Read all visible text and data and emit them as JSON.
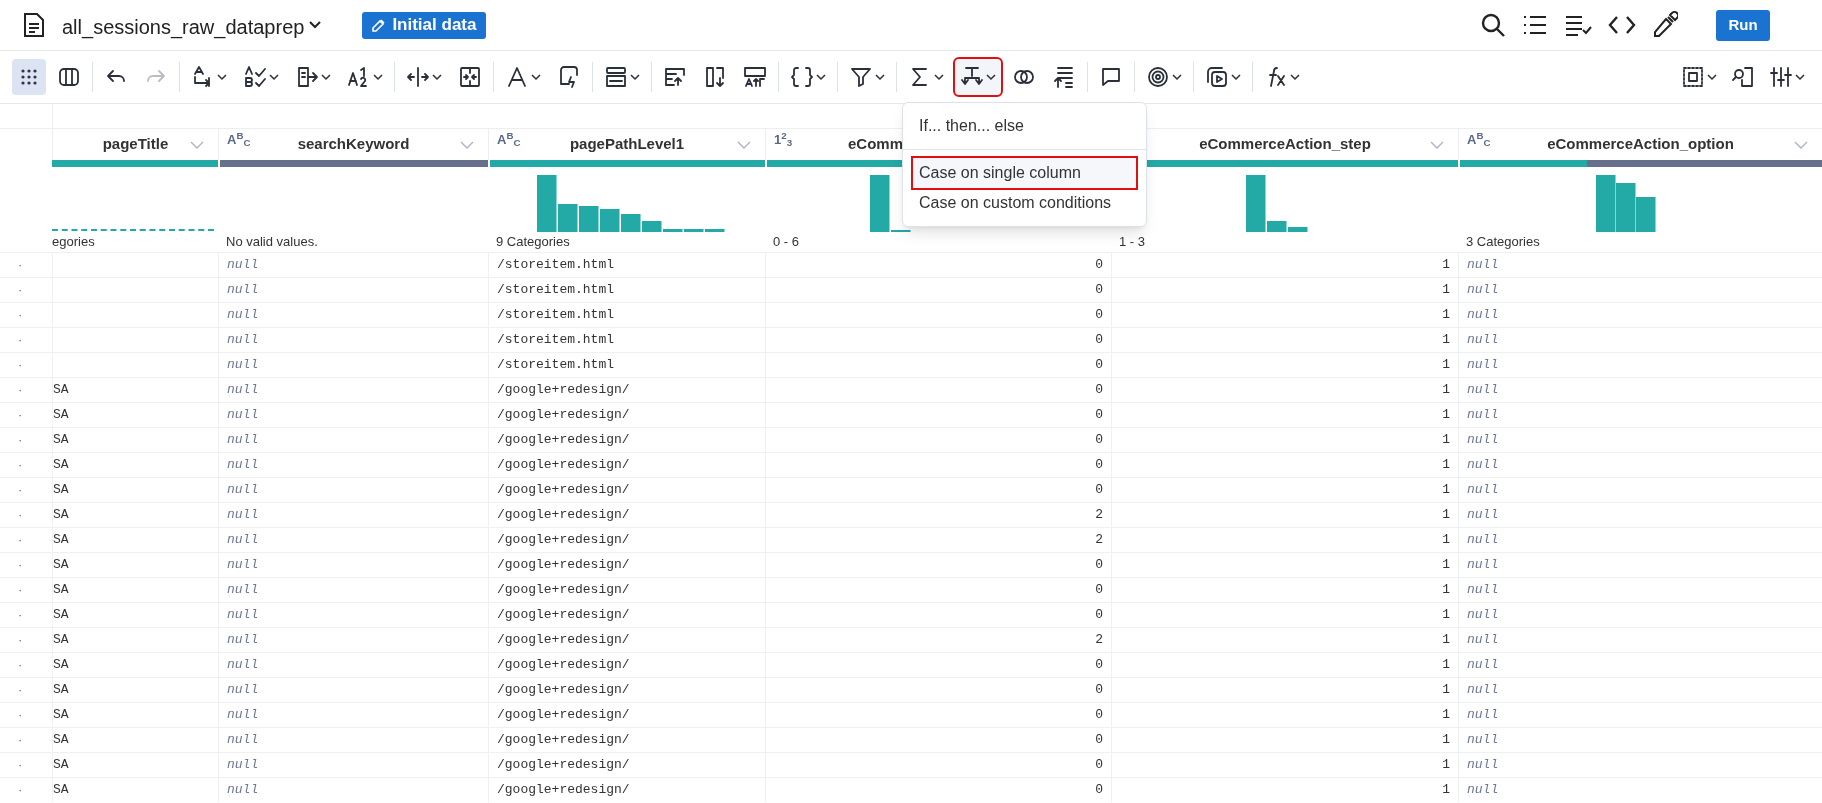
{
  "header": {
    "title": "all_sessions_raw_dataprep",
    "badge": "Initial data",
    "run_button": "Run"
  },
  "toolbar_left": [
    [
      {
        "kind": "grid",
        "caret": false,
        "selected": true
      },
      {
        "kind": "columns",
        "caret": false,
        "selected": false
      }
    ],
    [
      {
        "kind": "undo",
        "caret": false,
        "selected": false
      },
      {
        "kind": "redo",
        "caret": false,
        "selected": false,
        "disabled": true
      }
    ],
    [
      {
        "kind": "rename",
        "caret": true,
        "selected": false
      },
      {
        "kind": "spellcheck",
        "caret": true,
        "selected": false
      },
      {
        "kind": "export",
        "caret": true,
        "selected": false
      },
      {
        "kind": "numbering",
        "caret": true,
        "selected": false
      }
    ],
    [
      {
        "kind": "split",
        "caret": true,
        "selected": false
      },
      {
        "kind": "merge",
        "caret": false,
        "selected": false
      }
    ],
    [
      {
        "kind": "font",
        "caret": true,
        "selected": false
      },
      {
        "kind": "card",
        "caret": false,
        "selected": false
      }
    ],
    [
      {
        "kind": "rows",
        "caret": true,
        "selected": false
      }
    ],
    [
      {
        "kind": "table-up",
        "caret": false,
        "selected": false
      },
      {
        "kind": "column-down",
        "caret": false,
        "selected": false
      },
      {
        "kind": "text-up",
        "caret": false,
        "selected": false
      }
    ],
    [
      {
        "kind": "braces",
        "caret": true,
        "selected": false
      }
    ],
    [
      {
        "kind": "filter",
        "caret": true,
        "selected": false
      }
    ],
    [
      {
        "kind": "sigma",
        "caret": true,
        "selected": false
      },
      {
        "kind": "branch",
        "caret": true,
        "selected": false,
        "open": true
      },
      {
        "kind": "venn",
        "caret": false,
        "selected": false
      },
      {
        "kind": "sort",
        "caret": false,
        "selected": false
      }
    ],
    [
      {
        "kind": "comment",
        "caret": false,
        "selected": false
      }
    ],
    [
      {
        "kind": "target",
        "caret": true,
        "selected": false
      }
    ],
    [
      {
        "kind": "play",
        "caret": true,
        "selected": false
      }
    ],
    [
      {
        "kind": "fx",
        "caret": true,
        "selected": false
      }
    ]
  ],
  "toolbar_right": [
    {
      "kind": "frame",
      "caret": true,
      "selected": false
    },
    {
      "kind": "inspect",
      "caret": false,
      "selected": false
    },
    {
      "kind": "sliders",
      "caret": true,
      "selected": false
    }
  ],
  "menu": [
    {
      "label": "If... then... else",
      "highlighted": false
    },
    {
      "label": "Case on single column",
      "highlighted": true
    },
    {
      "label": "Case on custom conditions",
      "highlighted": false
    }
  ],
  "columns": [
    {
      "name": "pageTitle",
      "kind": "text",
      "level": 1,
      "summary": "egories"
    },
    {
      "name": "searchKeyword",
      "type_icon": "A$^{B}$$_{C}$",
      "kind": "missing",
      "level": 0,
      "summary": "No valid values."
    },
    {
      "name": "pagePathLevel1",
      "type_icon": "A$^{B}$$_{C}$",
      "kind": "text",
      "level": 1,
      "summary": "9 Categories"
    },
    {
      "name": "eComm",
      "clipped": true,
      "type_icon": "1$^{2}$$_{3}$",
      "kind": "number",
      "level": 1,
      "summary": "0 - 6"
    },
    {
      "name": "eCommerceAction_step",
      "kind": "number",
      "level": 1,
      "summary": "1 - 3"
    },
    {
      "name": "eCommerceAction_option",
      "type_icon": "A$^{B}$$_{C}$",
      "kind": "missing",
      "level": 0.35,
      "summary": "3 Categories"
    }
  ],
  "rows": [
    {
      "marker": "·",
      "cells": [
        null,
        "null",
        "/storeitem.html",
        "0",
        "1",
        "null"
      ]
    },
    {
      "marker": "·",
      "cells": [
        null,
        "null",
        "/storeitem.html",
        "0",
        "1",
        "null"
      ]
    },
    {
      "marker": "·",
      "cells": [
        null,
        "null",
        "/storeitem.html",
        "0",
        "1",
        "null"
      ]
    },
    {
      "marker": "·",
      "cells": [
        null,
        "null",
        "/storeitem.html",
        "0",
        "1",
        "null"
      ]
    },
    {
      "marker": "·",
      "cells": [
        null,
        "null",
        "/storeitem.html",
        "0",
        "1",
        "null"
      ]
    },
    {
      "marker": "·",
      "cells": [
        "SA",
        "null",
        "/google+redesign/",
        "0",
        "1",
        "null"
      ]
    },
    {
      "marker": "·",
      "cells": [
        "SA",
        "null",
        "/google+redesign/",
        "0",
        "1",
        "null"
      ]
    },
    {
      "marker": "·",
      "cells": [
        "SA",
        "null",
        "/google+redesign/",
        "0",
        "1",
        "null"
      ]
    },
    {
      "marker": "·",
      "cells": [
        "SA",
        "null",
        "/google+redesign/",
        "0",
        "1",
        "null"
      ]
    },
    {
      "marker": "·",
      "cells": [
        "SA",
        "null",
        "/google+redesign/",
        "0",
        "1",
        "null"
      ]
    },
    {
      "marker": "·",
      "cells": [
        "SA",
        "null",
        "/google+redesign/",
        "2",
        "1",
        "null"
      ]
    },
    {
      "marker": "·",
      "cells": [
        "SA",
        "null",
        "/google+redesign/",
        "2",
        "1",
        "null"
      ]
    },
    {
      "marker": "·",
      "cells": [
        "SA",
        "null",
        "/google+redesign/",
        "0",
        "1",
        "null"
      ]
    },
    {
      "marker": "·",
      "cells": [
        "SA",
        "null",
        "/google+redesign/",
        "0",
        "1",
        "null"
      ]
    },
    {
      "marker": "·",
      "cells": [
        "SA",
        "null",
        "/google+redesign/",
        "0",
        "1",
        "null"
      ]
    },
    {
      "marker": "·",
      "cells": [
        "SA",
        "null",
        "/google+redesign/",
        "2",
        "1",
        "null"
      ]
    },
    {
      "marker": "·",
      "cells": [
        "SA",
        "null",
        "/google+redesign/",
        "0",
        "1",
        "null"
      ]
    },
    {
      "marker": "·",
      "cells": [
        "SA",
        "null",
        "/google+redesign/",
        "0",
        "1",
        "null"
      ]
    },
    {
      "marker": "·",
      "cells": [
        "SA",
        "null",
        "/google+redesign/",
        "0",
        "1",
        "null"
      ]
    },
    {
      "marker": "·",
      "cells": [
        "SA",
        "null",
        "/google+redesign/",
        "0",
        "1",
        "null"
      ]
    },
    {
      "marker": "·",
      "cells": [
        "SA",
        "null",
        "/google+redesign/",
        "0",
        "1",
        "null"
      ]
    },
    {
      "marker": "·",
      "cells": [
        "SA",
        "null",
        "/google+redesign/",
        "0",
        "1",
        "null"
      ]
    }
  ]
}
